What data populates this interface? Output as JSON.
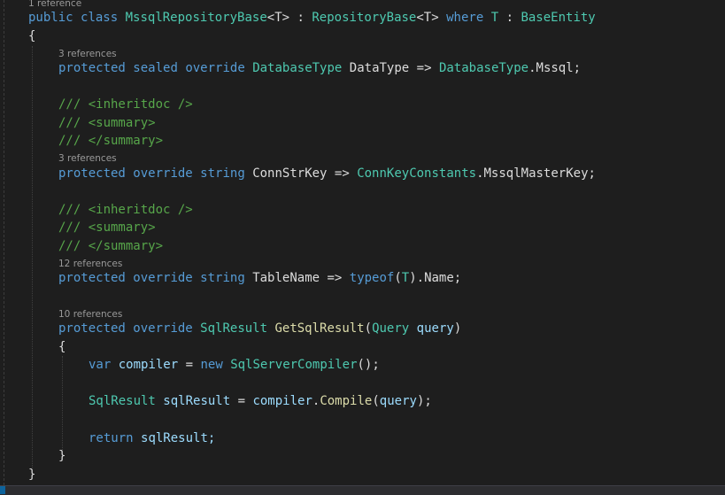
{
  "lens": {
    "class_refs": "1 reference",
    "datatype_refs": "3 references",
    "connstr_refs": "3 references",
    "tablename_refs": "12 references",
    "getsql_refs": "10 references"
  },
  "code": {
    "class_line": {
      "public": "public",
      "class": "class",
      "name": "MssqlRepositoryBase",
      "tparam": "<T>",
      "colon": " : ",
      "base": "RepositoryBase",
      "tparam2": "<T>",
      "where": "where",
      "T": "T",
      "colon2": " : ",
      "constraint": "BaseEntity"
    },
    "open_brace": "{",
    "datatype_line": {
      "protected": "protected",
      "sealed": "sealed",
      "override": "override",
      "type": "DatabaseType",
      "name": "DataType",
      "arrow": " => ",
      "value_type": "DatabaseType",
      "value_member": ".Mssql;"
    },
    "doc1": [
      "/// <inheritdoc />",
      "/// <summary>",
      "/// </summary>"
    ],
    "connstr_line": {
      "protected": "protected",
      "override": "override",
      "string": "string",
      "name": "ConnStrKey",
      "arrow": " => ",
      "value_type": "ConnKeyConstants",
      "value_member": ".MssqlMasterKey;"
    },
    "doc2": [
      "/// <inheritdoc />",
      "/// <summary>",
      "/// </summary>"
    ],
    "tablename_line": {
      "protected": "protected",
      "override": "override",
      "string": "string",
      "name": "TableName",
      "arrow": " => ",
      "typeof": "typeof",
      "paren_open": "(",
      "T": "T",
      "rest": ").Name;"
    },
    "getsql_line": {
      "protected": "protected",
      "override": "override",
      "return_type": "SqlResult",
      "method": "GetSqlResult",
      "paren_open": "(",
      "param_type": "Query",
      "param_name": "query",
      "paren_close": ")"
    },
    "method_open": "{",
    "compiler_line": {
      "var": "var",
      "name": "compiler",
      "eq": " = ",
      "new": "new",
      "type": "SqlServerCompiler",
      "rest": "();"
    },
    "sqlresult_line": {
      "type": "SqlResult",
      "name": "sqlResult",
      "eq": " = ",
      "obj": "compiler",
      "dot": ".",
      "method": "Compile",
      "paren_open": "(",
      "arg": "query",
      "rest": ");"
    },
    "return_line": {
      "return": "return",
      "rest": "sqlResult;"
    },
    "method_close": "}",
    "close_brace": "}"
  }
}
